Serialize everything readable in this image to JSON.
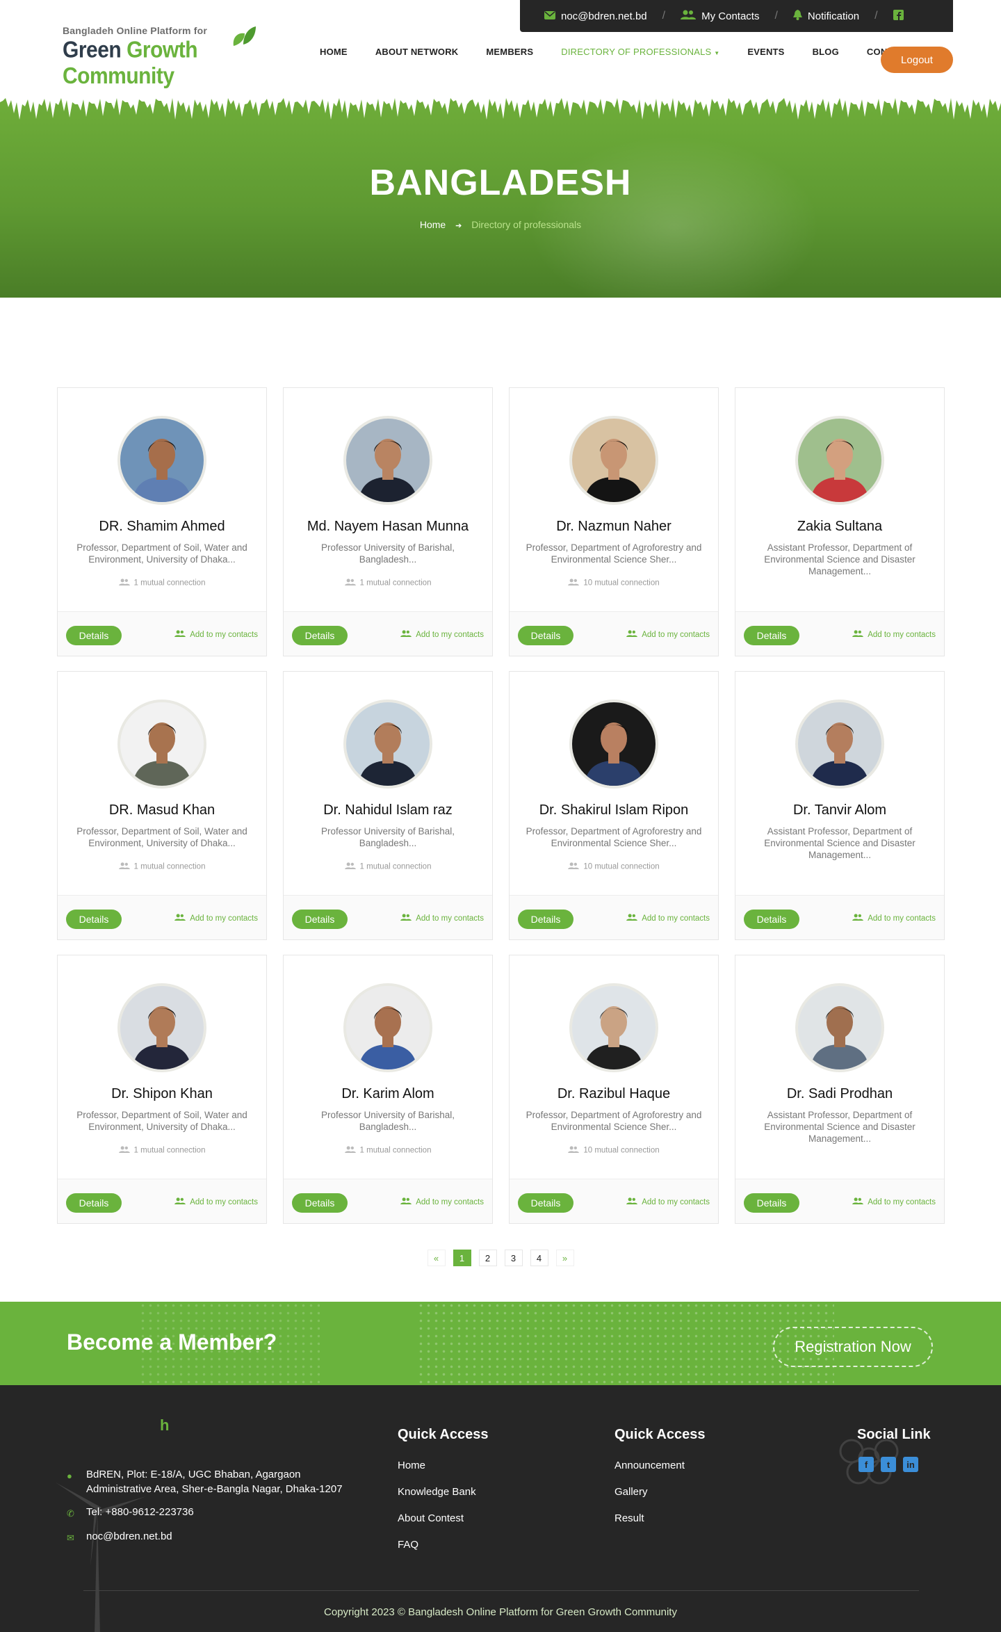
{
  "topbar": {
    "email": "noc@bdren.net.bd",
    "contacts": "My Contacts",
    "notification": "Notification"
  },
  "logo": {
    "line1": "Bangladeh Online Platform for",
    "green_word1": "Green",
    "green_word2": "Growth Community"
  },
  "nav": {
    "items": [
      "HOME",
      "ABOUT NETWORK",
      "MEMBERS",
      "DIRECTORY OF PROFESSIONALS",
      "EVENTS",
      "BLOG",
      "CONTACT US"
    ],
    "logout": "Logout"
  },
  "hero": {
    "title": "BANGLADESH",
    "crumb_home": "Home",
    "crumb_current": "Directory of professionals"
  },
  "cards": [
    {
      "name": "DR. Shamim Ahmed",
      "role": "Professor, Department of Soil, Water and Environment, University of Dhaka...",
      "mutual": "1 mutual connection",
      "bg": "#6f93b8",
      "shirt": "#5f7fb3",
      "skin": "#a66e4b",
      "hair": "#1e1a17"
    },
    {
      "name": "Md. Nayem Hasan Munna",
      "role": "Professor University of Barishal, Bangladesh...",
      "mutual": "1 mutual connection",
      "bg": "#a7b6c4",
      "shirt": "#1c2230",
      "skin": "#b98462",
      "hair": "#1a1410"
    },
    {
      "name": "Dr. Nazmun Naher",
      "role": "Professor, Department of Agroforestry and Environmental Science Sher...",
      "mutual": "10 mutual connection",
      "bg": "#d8c2a2",
      "shirt": "#141414",
      "skin": "#c89674",
      "hair": "#1a130e"
    },
    {
      "name": "Zakia Sultana",
      "role": "Assistant Professor, Department of Environmental Science and Disaster Management...",
      "mutual": "",
      "bg": "#9fbf8d",
      "shirt": "#c8393b",
      "skin": "#d3a07f",
      "hair": "#1e1510"
    },
    {
      "name": "DR. Masud Khan",
      "role": "Professor, Department of Soil, Water and Environment, University of Dhaka...",
      "mutual": "1 mutual connection",
      "bg": "#f2f2f2",
      "shirt": "#5f6658",
      "skin": "#a8734f",
      "hair": "#1b1612"
    },
    {
      "name": "Dr. Nahidul Islam raz",
      "role": "Professor University of Barishal, Bangladesh...",
      "mutual": "1 mutual connection",
      "bg": "#c7d4de",
      "shirt": "#1d2535",
      "skin": "#b27d5b",
      "hair": "#18120e"
    },
    {
      "name": "Dr. Shakirul Islam Ripon",
      "role": "Professor, Department of Agroforestry and Environmental Science Sher...",
      "mutual": "10 mutual connection",
      "bg": "#1a1a1a",
      "shirt": "#2b3f6b",
      "skin": "#b98061",
      "hair": "#120e0b"
    },
    {
      "name": "Dr. Tanvir Alom",
      "role": "Assistant Professor, Department of Environmental Science and Disaster Management...",
      "mutual": "",
      "bg": "#cfd6dc",
      "shirt": "#1f2b4c",
      "skin": "#b47e5e",
      "hair": "#1c1611"
    },
    {
      "name": "Dr. Shipon Khan",
      "role": "Professor, Department of Soil, Water and Environment, University of Dhaka...",
      "mutual": "1 mutual connection",
      "bg": "#d9dde2",
      "shirt": "#23263a",
      "skin": "#b07b58",
      "hair": "#161210"
    },
    {
      "name": "Dr. Karim Alom",
      "role": "Professor University of Barishal, Bangladesh...",
      "mutual": "1 mutual connection",
      "bg": "#ececec",
      "shirt": "#3a5ea3",
      "skin": "#a87150",
      "hair": "#1a1511"
    },
    {
      "name": "Dr. Razibul Haque",
      "role": "Professor, Department of Agroforestry and Environmental Science Sher...",
      "mutual": "10 mutual connection",
      "bg": "#dfe4e8",
      "shirt": "#202020",
      "skin": "#caa384",
      "hair": "#3a3a3a"
    },
    {
      "name": "Dr. Sadi Prodhan",
      "role": "Assistant Professor, Department of Environmental Science and Disaster Management...",
      "mutual": "",
      "bg": "#e0e4e6",
      "shirt": "#5f6f82",
      "skin": "#a06f4f",
      "hair": "#2b2723"
    }
  ],
  "card_labels": {
    "details": "Details",
    "add": "Add to my contacts"
  },
  "pagination": {
    "prev": "«",
    "pages": [
      "1",
      "2",
      "3",
      "4"
    ],
    "next": "»"
  },
  "cta": {
    "title": "Become a Member?",
    "button": "Registration Now"
  },
  "footer": {
    "logo_letter": "h",
    "address": "BdREN, Plot: E-18/A, UGC Bhaban, Agargaon Administrative Area, Sher-e-Bangla Nagar, Dhaka-1207",
    "tel": "Tel: +880-9612-223736",
    "email": "noc@bdren.net.bd",
    "col1_title": "Quick Access",
    "col1_links": [
      "Home",
      "Knowledge Bank",
      "About Contest",
      "FAQ"
    ],
    "col2_title": "Quick Access",
    "col2_links": [
      "Announcement",
      "Gallery",
      "Result"
    ],
    "social_title": "Social Link",
    "copyright": "Copyright 2023 © Bangladesh Online Platform for Green Growth Community"
  },
  "colors": {
    "brand_green": "#6ab33d",
    "logout_orange": "#e07b2c",
    "dark": "#262626"
  }
}
